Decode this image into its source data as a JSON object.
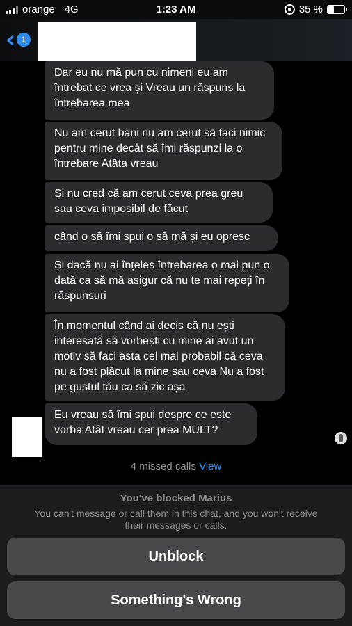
{
  "status_bar": {
    "carrier": "orange",
    "network": "4G",
    "time": "1:23 AM",
    "battery": "35 %",
    "battery_level": 0.35
  },
  "header": {
    "back_badge": "1"
  },
  "messages": [
    "Dar eu nu mă pun cu nimeni eu am întrebat ce vrea și Vreau un răspuns la întrebarea mea",
    "Nu am cerut bani nu am cerut să faci nimic pentru mine decât să îmi răspunzi la o întrebare Atâta vreau",
    "Și nu cred că am cerut ceva prea greu sau ceva imposibil de făcut",
    "când o să îmi spui o să mă și eu opresc",
    "Și dacă nu ai înțeles întrebarea o mai pun o dată ca să mă asigur că nu te mai repeți în răspunsuri",
    "În momentul când ai decis că nu ești interesată să vorbești cu mine ai avut un motiv să faci asta cel mai probabil că ceva nu a fost plăcut la mine sau ceva Nu a fost pe gustul tău ca să zic așa",
    "Eu vreau să îmi spui despre ce este vorba Atât vreau cer prea MULT?"
  ],
  "missed_calls": {
    "text": "4 missed calls",
    "link": "View"
  },
  "blocked": {
    "title": "You've blocked Marius",
    "description": "You can't message or call them in this chat, and you won't receive their messages or calls."
  },
  "buttons": {
    "unblock": "Unblock",
    "something_wrong": "Something's Wrong"
  },
  "colors": {
    "accent": "#2d8cf0",
    "bubble": "#2c2c2e",
    "panel": "#1c1c1e",
    "button": "#48484a"
  }
}
